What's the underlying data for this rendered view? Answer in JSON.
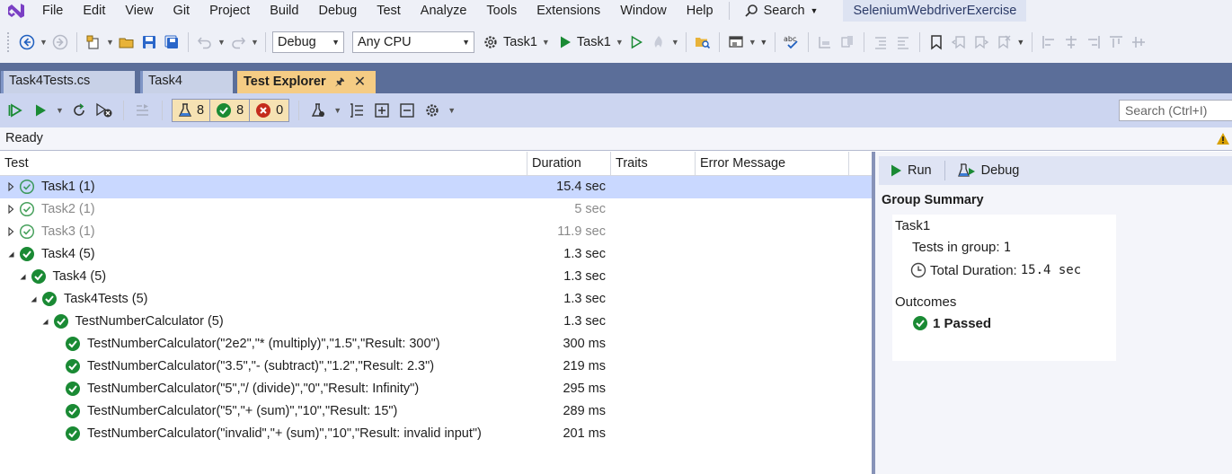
{
  "menu": {
    "items": [
      "File",
      "Edit",
      "View",
      "Git",
      "Project",
      "Build",
      "Debug",
      "Test",
      "Analyze",
      "Tools",
      "Extensions",
      "Window",
      "Help"
    ],
    "search_label": "Search",
    "solution_name": "SeleniumWebdriverExercise"
  },
  "toolbar": {
    "configuration": "Debug",
    "platform": "Any CPU",
    "startup_project": "Task1",
    "start_target": "Task1"
  },
  "tabs": [
    {
      "label": "Task4Tests.cs",
      "active": false
    },
    {
      "label": "Task4",
      "active": false
    },
    {
      "label": "Test Explorer",
      "active": true
    }
  ],
  "test_explorer": {
    "counts": {
      "total": "8",
      "passed": "8",
      "failed": "0"
    },
    "search_placeholder": "Search (Ctrl+I)",
    "status": "Ready",
    "columns": [
      "Test",
      "Duration",
      "Traits",
      "Error Message"
    ],
    "rows": [
      {
        "name": "Task1  (1)",
        "duration": "15.4 sec",
        "level": 0,
        "expander": "collapsed",
        "status": "passed-outline",
        "selected": true,
        "dim": false
      },
      {
        "name": "Task2  (1)",
        "duration": "5 sec",
        "level": 0,
        "expander": "collapsed",
        "status": "passed-outline",
        "selected": false,
        "dim": true
      },
      {
        "name": "Task3  (1)",
        "duration": "11.9 sec",
        "level": 0,
        "expander": "collapsed",
        "status": "passed-outline",
        "selected": false,
        "dim": true
      },
      {
        "name": "Task4  (5)",
        "duration": "1.3 sec",
        "level": 0,
        "expander": "expanded",
        "status": "passed",
        "selected": false,
        "dim": false
      },
      {
        "name": "Task4  (5)",
        "duration": "1.3 sec",
        "level": 1,
        "expander": "expanded",
        "status": "passed",
        "selected": false,
        "dim": false
      },
      {
        "name": "Task4Tests  (5)",
        "duration": "1.3 sec",
        "level": 2,
        "expander": "expanded",
        "status": "passed",
        "selected": false,
        "dim": false
      },
      {
        "name": "TestNumberCalculator  (5)",
        "duration": "1.3 sec",
        "level": 3,
        "expander": "expanded",
        "status": "passed",
        "selected": false,
        "dim": false
      },
      {
        "name": "TestNumberCalculator(\"2e2\",\"* (multiply)\",\"1.5\",\"Result: 300\")",
        "duration": "300 ms",
        "level": 4,
        "expander": "none",
        "status": "passed",
        "selected": false,
        "dim": false
      },
      {
        "name": "TestNumberCalculator(\"3.5\",\"- (subtract)\",\"1.2\",\"Result: 2.3\")",
        "duration": "219 ms",
        "level": 4,
        "expander": "none",
        "status": "passed",
        "selected": false,
        "dim": false
      },
      {
        "name": "TestNumberCalculator(\"5\",\"/ (divide)\",\"0\",\"Result: Infinity\")",
        "duration": "295 ms",
        "level": 4,
        "expander": "none",
        "status": "passed",
        "selected": false,
        "dim": false
      },
      {
        "name": "TestNumberCalculator(\"5\",\"+ (sum)\",\"10\",\"Result: 15\")",
        "duration": "289 ms",
        "level": 4,
        "expander": "none",
        "status": "passed",
        "selected": false,
        "dim": false
      },
      {
        "name": "TestNumberCalculator(\"invalid\",\"+ (sum)\",\"10\",\"Result: invalid input\")",
        "duration": "201 ms",
        "level": 4,
        "expander": "none",
        "status": "passed",
        "selected": false,
        "dim": false
      }
    ]
  },
  "detail": {
    "run_label": "Run",
    "debug_label": "Debug",
    "group_summary_title": "Group Summary",
    "group_name": "Task1",
    "tests_in_group_label": "Tests in group:",
    "tests_in_group_value": "1",
    "total_duration_label": "Total Duration:",
    "total_duration_value": "15.4 sec",
    "outcomes_label": "Outcomes",
    "passed_label": "1 Passed"
  },
  "colors": {
    "passed_green": "#1a8a34",
    "failed_red": "#c42b1c",
    "accent_blue": "#5b6e99",
    "selected_row": "#c9d8ff",
    "active_tab": "#f5cc84"
  }
}
